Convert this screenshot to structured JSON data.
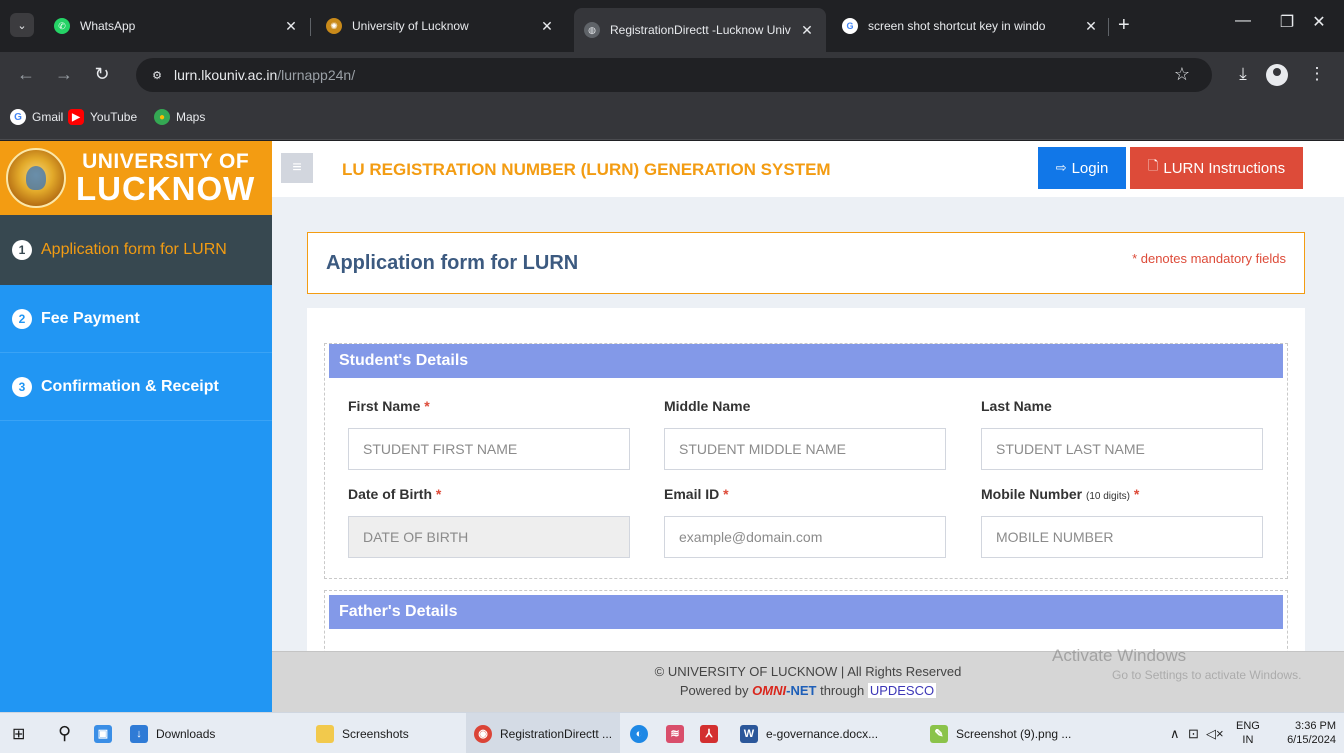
{
  "browser": {
    "tabs": [
      {
        "title": "WhatsApp",
        "active": false,
        "favicon_color": "#25d366"
      },
      {
        "title": "University of Lucknow",
        "active": false,
        "favicon_color": "#c98a1a"
      },
      {
        "title": "RegistrationDirectt -Lucknow Univ",
        "active": true,
        "favicon_color": "#5f6368"
      },
      {
        "title": "screen shot shortcut key in windo",
        "active": false,
        "favicon_color": "#ffffff"
      }
    ],
    "url_host": "lurn.lkouniv.ac.in",
    "url_path": "/lurnapp24n/",
    "bookmarks": [
      "Gmail",
      "YouTube",
      "Maps"
    ]
  },
  "site": {
    "logo_line1": "UNIVERSITY OF",
    "logo_line2": "LUCKNOW",
    "system_title": "LU REGISTRATION NUMBER (LURN) GENERATION SYSTEM",
    "login_label": "Login",
    "instructions_label": "LURN Instructions"
  },
  "sidebar": {
    "steps": [
      {
        "num": "1",
        "label": "Application form for LURN",
        "active": true
      },
      {
        "num": "2",
        "label": "Fee Payment",
        "active": false
      },
      {
        "num": "3",
        "label": "Confirmation & Receipt",
        "active": false
      }
    ]
  },
  "form": {
    "title": "Application form for LURN",
    "mandatory_note": "* denotes mandatory fields",
    "students_section": "Student's Details",
    "fathers_section": "Father's Details",
    "fields": {
      "first_name": {
        "label": "First Name",
        "placeholder": "STUDENT FIRST NAME"
      },
      "middle_name": {
        "label": "Middle Name",
        "placeholder": "STUDENT MIDDLE NAME"
      },
      "last_name": {
        "label": "Last Name",
        "placeholder": "STUDENT LAST NAME"
      },
      "dob": {
        "label": "Date of Birth",
        "placeholder": "DATE OF BIRTH"
      },
      "email": {
        "label": "Email ID",
        "placeholder": "example@domain.com"
      },
      "mobile": {
        "label": "Mobile Number",
        "hint": "(10 digits)",
        "placeholder": "MOBILE NUMBER"
      }
    },
    "required_mark": "*"
  },
  "footer": {
    "copyright": "© UNIVERSITY OF LUCKNOW  | All Rights Reserved",
    "powered_by": "Powered by",
    "omni": "OMNI",
    "net": "-NET",
    "through": "through",
    "updesco": "UPDESCO",
    "watermark_title": "Activate Windows",
    "watermark_sub": "Go to Settings to activate Windows."
  },
  "taskbar": {
    "items": [
      "Downloads",
      "Screenshots",
      "RegistrationDirectt ...",
      "e-governance.docx...",
      "Screenshot (9).png ..."
    ],
    "lang_top": "ENG",
    "lang_bottom": "IN",
    "time": "3:36 PM",
    "date": "6/15/2024"
  },
  "colors": {
    "brand_orange": "#f39c12",
    "sidebar_blue": "#2196f3",
    "login_blue": "#1177e8",
    "instructions_red": "#dd4b39",
    "section_head": "#8399e8"
  }
}
